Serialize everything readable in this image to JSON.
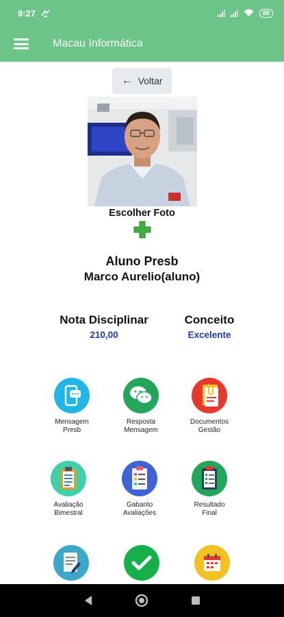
{
  "status_bar": {
    "time": "9:27",
    "battery": "88"
  },
  "app_bar": {
    "title": "Macau Informática"
  },
  "back_button": {
    "label": "Voltar"
  },
  "photo": {
    "choose_label": "Escolher Foto"
  },
  "student": {
    "type": "Aluno Presb",
    "name": "Marco Aurelio(aluno)"
  },
  "grades": {
    "discipline": {
      "title": "Nota Disciplinar",
      "value": "210,00"
    },
    "concept": {
      "title": "Conceito",
      "value": "Excelente"
    }
  },
  "menu": [
    {
      "line1": "Mensagem",
      "line2": "Presb",
      "icon": "phone-chat-icon"
    },
    {
      "line1": "Resposta",
      "line2": "Mensagem",
      "icon": "wechat-icon"
    },
    {
      "line1": "Documentos",
      "line2": "Gestão",
      "icon": "documents-icon"
    },
    {
      "line1": "Avaliação",
      "line2": "Bimestral",
      "icon": "clipboard-icon"
    },
    {
      "line1": "Gabarito",
      "line2": "Avaliações",
      "icon": "checklist-icon"
    },
    {
      "line1": "Resultado",
      "line2": "Final",
      "icon": "result-clipboard-icon"
    },
    {
      "line1": "",
      "line2": "",
      "icon": "note-edit-icon"
    },
    {
      "line1": "",
      "line2": "",
      "icon": "check-icon"
    },
    {
      "line1": "",
      "line2": "",
      "icon": "calendar-icon"
    }
  ],
  "colors": {
    "primary": "#6cc489",
    "value_blue": "#1a3aa7",
    "plus_green": "#3fae3f"
  }
}
